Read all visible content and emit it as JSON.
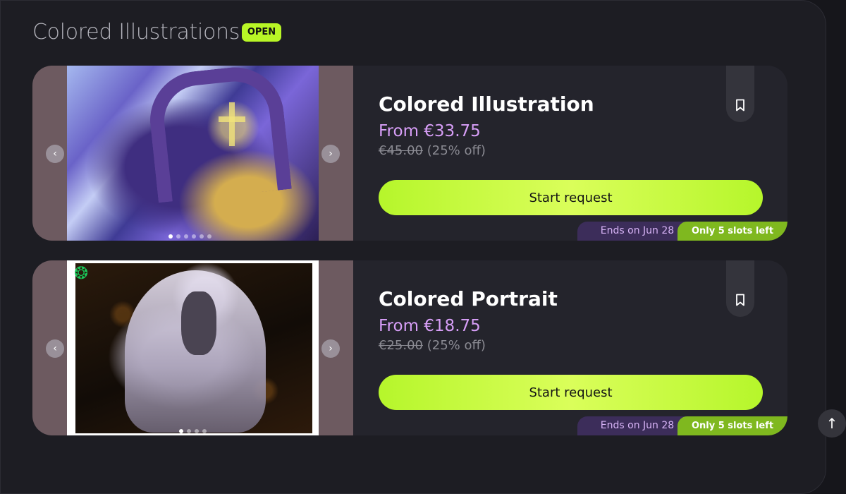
{
  "section": {
    "title": "Colored Illustrations",
    "badge": "OPEN"
  },
  "cards": [
    {
      "title": "Colored Illustration",
      "price": "From €33.75",
      "old_price": "€45.00",
      "discount": "(25% off)",
      "button_label": "Start request",
      "ends_label": "Ends on Jun 28",
      "slots_label": "Only 5 slots left"
    },
    {
      "title": "Colored Portrait",
      "price": "From €18.75",
      "old_price": "€25.00",
      "discount": "(25% off)",
      "button_label": "Start request",
      "ends_label": "Ends on Jun 28",
      "slots_label": "Only 5 slots left"
    }
  ],
  "colors": {
    "accent": "#b8f626",
    "price": "#d79ef7",
    "ends_tag": "#3c2d5a",
    "slots_tag": "#7fb81f"
  },
  "icons": {
    "prev": "chevron-left-icon",
    "next": "chevron-right-icon",
    "bookmark": "bookmark-icon",
    "scroll_top": "arrow-up-icon"
  }
}
